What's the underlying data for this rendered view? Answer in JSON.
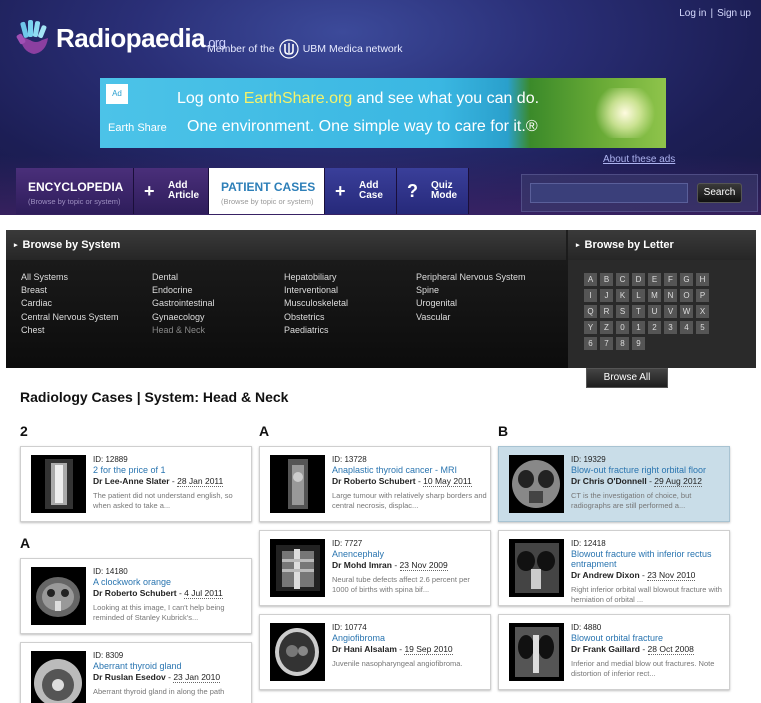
{
  "header": {
    "logo_text": "Radiopaedia",
    "logo_suffix": ".org",
    "member_prefix": "Member of the",
    "member_network": "UBM Medica network",
    "login": "Log in",
    "separator": "|",
    "signup": "Sign up"
  },
  "ad": {
    "brand_box": "Ad",
    "brand_name": "Earth Share",
    "line1_pre": "Log onto ",
    "line1_link": "EarthShare.org",
    "line1_post": " and see what you can do.",
    "line2": "One environment. One simple way to care for it.®",
    "about": "About these ads"
  },
  "tabs": {
    "encyclopedia": "ENCYCLOPEDIA",
    "encyclopedia_sub": "(Browse by topic or system)",
    "add_article_1": "Add",
    "add_article_2": "Article",
    "patient_cases": "PATIENT CASES",
    "patient_cases_sub": "(Browse by topic or system)",
    "add_case_1": "Add",
    "add_case_2": "Case",
    "quiz_1": "Quiz",
    "quiz_2": "Mode",
    "plus_symbol": "+",
    "quiz_symbol": "?"
  },
  "search": {
    "placeholder": "",
    "button": "Search"
  },
  "browse": {
    "system_header": "Browse by System",
    "letter_header": "Browse by Letter",
    "tri": "▸",
    "col1": [
      "All Systems",
      "Breast",
      "Cardiac",
      "Central Nervous System",
      "Chest"
    ],
    "col2": [
      "Dental",
      "Endocrine",
      "Gastrointestinal",
      "Gynaecology",
      "Head & Neck"
    ],
    "col3": [
      "Hepatobiliary",
      "Interventional",
      "Musculoskeletal",
      "Obstetrics",
      "Paediatrics"
    ],
    "col4": [
      "Peripheral Nervous System",
      "Spine",
      "Urogenital",
      "Vascular"
    ],
    "selected": "Head & Neck",
    "letters": [
      "A",
      "B",
      "C",
      "D",
      "E",
      "F",
      "G",
      "H",
      "I",
      "J",
      "K",
      "L",
      "M",
      "N",
      "O",
      "P",
      "Q",
      "R",
      "S",
      "T",
      "U",
      "V",
      "W",
      "X",
      "Y",
      "Z",
      "0",
      "1",
      "2",
      "3",
      "4",
      "5",
      "6",
      "7",
      "8",
      "9"
    ],
    "browse_all": "Browse All"
  },
  "main": {
    "title": "Radiology Cases | System: Head & Neck",
    "groups": {
      "g1": "2",
      "g2": "A",
      "g3": "A",
      "g4": "B"
    },
    "cases": [
      {
        "id": "ID: 12889",
        "title": "2 for the price of 1",
        "author": "Dr Lee-Anne Slater",
        "date": "28 Jan 2011",
        "desc": "The patient did not understand english, so when asked to take a..."
      },
      {
        "id": "ID: 14180",
        "title": "A clockwork orange",
        "author": "Dr Roberto Schubert",
        "date": "4 Jul 2011",
        "desc": "Looking at this image, I can't help being reminded of Stanley Kubrick's..."
      },
      {
        "id": "ID: 8309",
        "title": "Aberrant thyroid gland",
        "author": "Dr Ruslan Esedov",
        "date": "23 Jan 2010",
        "desc": "Aberrant thyroid gland in along the path"
      },
      {
        "id": "ID: 13728",
        "title": "Anaplastic thyroid cancer - MRI",
        "author": "Dr Roberto Schubert",
        "date": "10 May 2011",
        "desc": "Large tumour with relatively sharp borders and central necrosis, displac..."
      },
      {
        "id": "ID: 7727",
        "title": "Anencephaly",
        "author": "Dr Mohd Imran",
        "date": "23 Nov 2009",
        "desc": "Neural tube defects affect 2.6 percent per 1000 of births with spina bif..."
      },
      {
        "id": "ID: 10774",
        "title": "Angiofibroma",
        "author": "Dr Hani Alsalam",
        "date": "19 Sep 2010",
        "desc": "Juvenile nasopharyngeal angiofibroma."
      },
      {
        "id": "ID: 19329",
        "title": "Blow-out fracture right orbital floor",
        "author": "Dr Chris O'Donnell",
        "date": "29 Aug 2012",
        "desc": "CT is the investigation of choice, but radiographs are still performed a..."
      },
      {
        "id": "ID: 12418",
        "title": "Blowout fracture with inferior rectus entrapment",
        "author": "Dr Andrew Dixon",
        "date": "23 Nov 2010",
        "desc": "Right inferior orbital wall blowout fracture with herniation of orbital ..."
      },
      {
        "id": "ID: 4880",
        "title": "Blowout orbital fracture",
        "author": "Dr Frank Gaillard",
        "date": "28 Oct 2008",
        "desc": "Inferior and medial blow out fractures. Note distortion of inferior rect..."
      }
    ],
    "date_sep": " - "
  }
}
